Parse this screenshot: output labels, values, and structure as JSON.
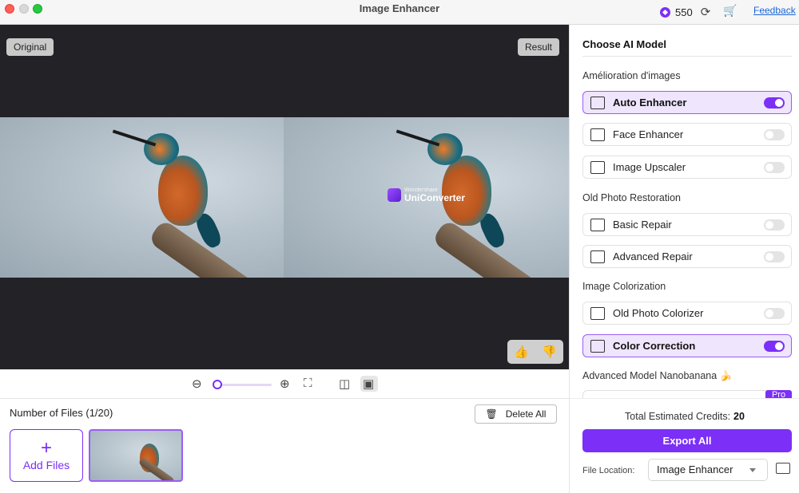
{
  "window": {
    "title": "Image Enhancer"
  },
  "header": {
    "credits": "550",
    "credit_icon": "credit-gem-icon",
    "refresh_icon": "refresh-icon",
    "cart_icon": "cart-icon",
    "feedback_label": "Feedback"
  },
  "preview": {
    "original_label": "Original",
    "result_label": "Result",
    "watermark_small": "Wondershare",
    "watermark_big": "UniConverter",
    "thumbs_up": "👍",
    "thumbs_down": "👎"
  },
  "zoombar": {
    "zoom_out": "⊖",
    "zoom_in": "⊕",
    "fullscreen": "⛶",
    "split_view": "◫",
    "side_by_side": "▣",
    "zoom_level": 0.0
  },
  "files": {
    "count_label": "Number of Files (1/20)",
    "delete_label": "Delete All",
    "add_label": "Add Files",
    "add_plus": "+"
  },
  "panel": {
    "title": "Choose AI Model",
    "sections": {
      "enhance": "Amélioration d'images",
      "old_photo": "Old Photo Restoration",
      "colorization": "Image Colorization",
      "advanced": "Advanced Model Nanobanana 🍌"
    },
    "models": [
      {
        "name": "Auto Enhancer",
        "on": true
      },
      {
        "name": "Face Enhancer",
        "on": false
      },
      {
        "name": "Image Upscaler",
        "on": false
      },
      {
        "name": "Basic Repair",
        "on": false
      },
      {
        "name": "Advanced Repair",
        "on": false
      },
      {
        "name": "Old Photo Colorizer",
        "on": false
      },
      {
        "name": "Color Correction",
        "on": true
      }
    ],
    "pro_badge": "Pro",
    "credits_label": "Total Estimated Credits:",
    "credits_value": "20",
    "export_label": "Export All",
    "location_label": "File Location:",
    "location_value": "Image Enhancer"
  },
  "colors": {
    "accent": "#7b2ff7",
    "dark_bg": "#232227"
  }
}
